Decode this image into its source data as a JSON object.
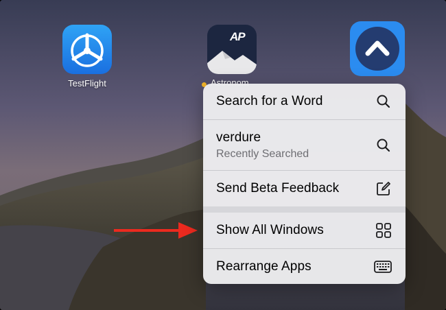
{
  "apps": [
    {
      "name": "TestFlight",
      "icon": "testflight-propeller-icon",
      "color": "#1f86ee"
    },
    {
      "name": "",
      "icon": "astronomer-mountain-icon",
      "color": "#1c2640"
    },
    {
      "name": "",
      "icon": "chevron-up-icon",
      "color": "#2b8cf0"
    }
  ],
  "behind_label": "Astronom",
  "ap_logo_text": "AP",
  "menu": {
    "items": [
      {
        "label": "Search for a Word",
        "sublabel": "",
        "icon": "search-icon"
      },
      {
        "label": "verdure",
        "sublabel": "Recently Searched",
        "icon": "search-icon"
      },
      {
        "label": "Send Beta Feedback",
        "sublabel": "",
        "icon": "compose-icon"
      },
      {
        "label": "Show All Windows",
        "sublabel": "",
        "icon": "grid-icon"
      },
      {
        "label": "Rearrange Apps",
        "sublabel": "",
        "icon": "keyboard-icon"
      }
    ]
  },
  "annotation": {
    "type": "arrow",
    "color": "#ec2a1f",
    "points_to": "Show All Windows"
  }
}
